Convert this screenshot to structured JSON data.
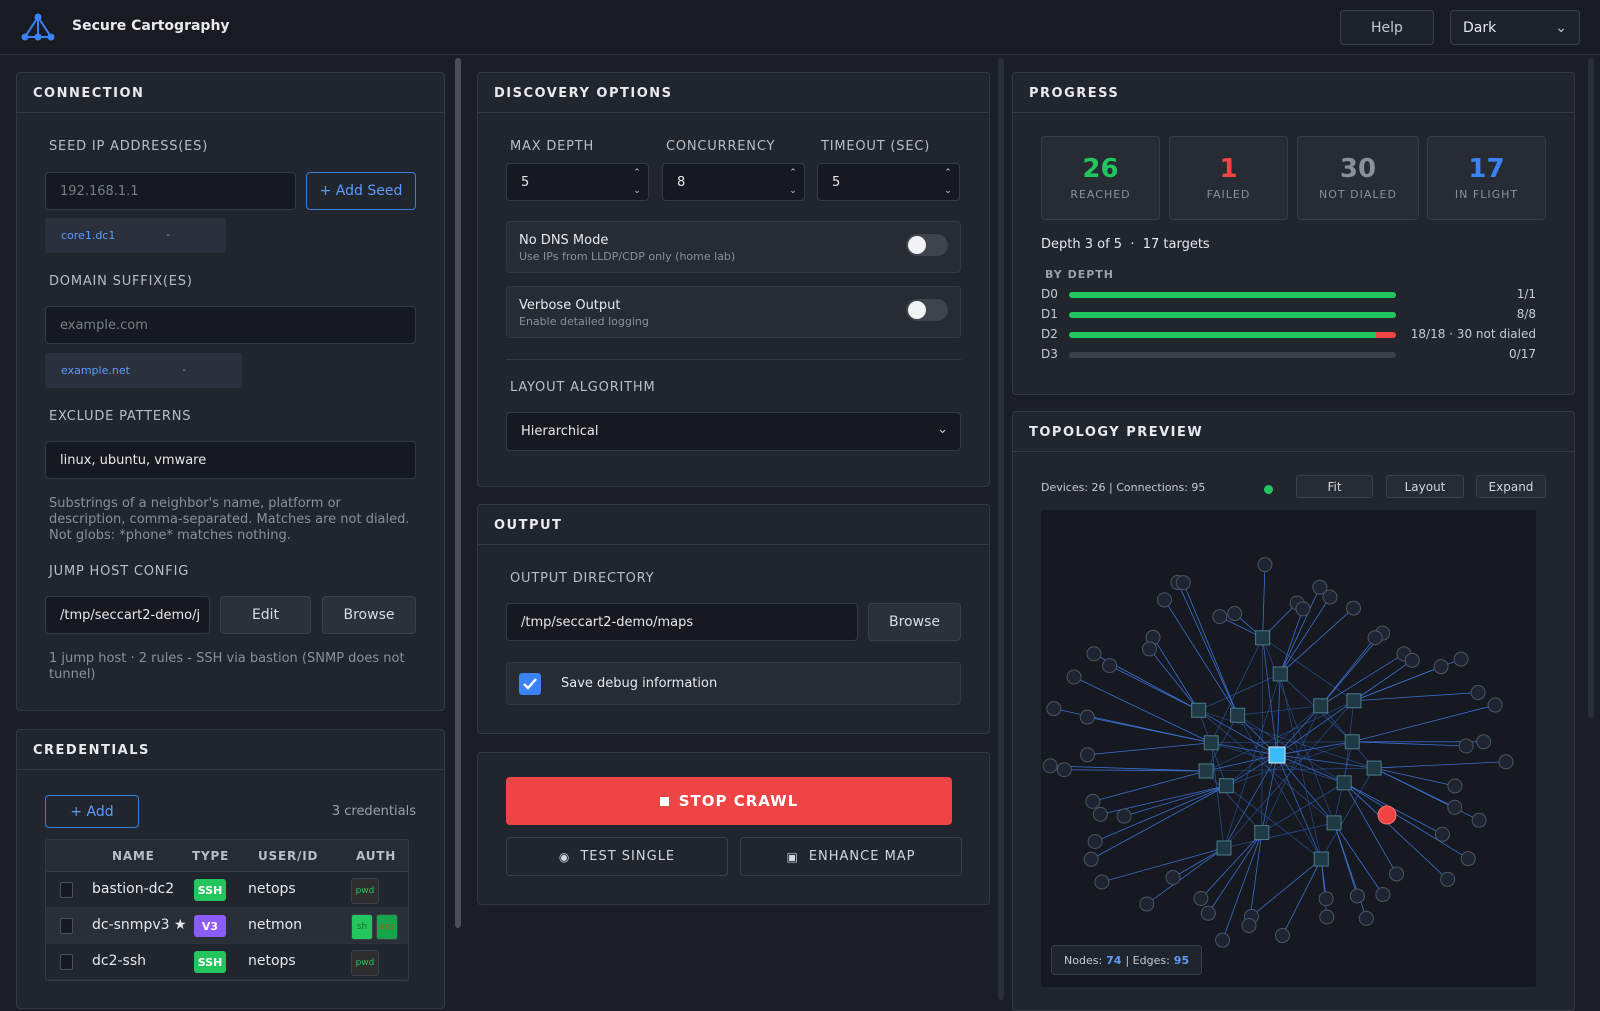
{
  "app": {
    "title": "Secure Cartography",
    "help_label": "Help",
    "theme": "Dark"
  },
  "connection": {
    "title": "CONNECTION",
    "seed_label": "SEED IP ADDRESS(ES)",
    "seed_placeholder": "192.168.1.1",
    "add_seed_label": "+ Add Seed",
    "seed_tags": [
      "core1.dc1"
    ],
    "domain_label": "DOMAIN SUFFIX(ES)",
    "domain_placeholder": "example.com",
    "domain_tags": [
      "example.net"
    ],
    "exclude_label": "EXCLUDE PATTERNS",
    "exclude_value": "linux, ubuntu, vmware",
    "exclude_help": [
      "Substrings of a neighbor's name, platform or",
      "description, comma-separated. Matches are not dialed.",
      "Not globs: *phone* matches nothing."
    ],
    "jump_label": "JUMP HOST CONFIG",
    "jump_value": "/tmp/seccart2-demo/j",
    "edit_label": "Edit",
    "browse_label": "Browse",
    "jump_help": [
      "1 jump host · 2 rules - SSH via bastion (SNMP does not",
      "tunnel)"
    ]
  },
  "credentials": {
    "title": "CREDENTIALS",
    "add_label": "+ Add",
    "count_text": "3 credentials",
    "headers": [
      "NAME",
      "TYPE",
      "USER/ID",
      "AUTH"
    ],
    "rows": [
      {
        "name": "bastion-dc2",
        "type": "SSH",
        "user": "netops",
        "auth": [
          "pwd"
        ]
      },
      {
        "name": "dc-snmpv3 ★",
        "type": "V3",
        "user": "netmon",
        "auth": [
          "sh",
          "aes"
        ]
      },
      {
        "name": "dc2-ssh",
        "type": "SSH",
        "user": "netops",
        "auth": [
          "pwd"
        ]
      }
    ]
  },
  "discovery": {
    "title": "DISCOVERY OPTIONS",
    "max_depth_label": "MAX DEPTH",
    "max_depth": "5",
    "concurrency_label": "CONCURRENCY",
    "concurrency": "8",
    "timeout_label": "TIMEOUT (SEC)",
    "timeout": "5",
    "no_dns_title": "No DNS Mode",
    "no_dns_sub": "Use IPs from LLDP/CDP only (home lab)",
    "verbose_title": "Verbose Output",
    "verbose_sub": "Enable detailed logging",
    "layout_label": "LAYOUT ALGORITHM",
    "layout_value": "Hierarchical"
  },
  "output": {
    "title": "OUTPUT",
    "dir_label": "OUTPUT DIRECTORY",
    "dir_value": "/tmp/seccart2-demo/maps",
    "browse_label": "Browse",
    "debug_label": "Save debug information"
  },
  "actions": {
    "stop_label": "STOP CRAWL",
    "test_label": "TEST SINGLE",
    "enhance_label": "ENHANCE MAP"
  },
  "progress": {
    "title": "PROGRESS",
    "stats": [
      {
        "value": "26",
        "label": "REACHED",
        "color": "#22c55e"
      },
      {
        "value": "1",
        "label": "FAILED",
        "color": "#ef4444"
      },
      {
        "value": "30",
        "label": "NOT DIALED",
        "color": "#8a8f99"
      },
      {
        "value": "17",
        "label": "IN FLIGHT",
        "color": "#3b82f6"
      }
    ],
    "depth_text": "Depth 3 of 5  ·  17 targets",
    "by_depth_label": "BY DEPTH",
    "depths": [
      {
        "label": "D0",
        "fraction": 1.0,
        "failed_fraction": 0,
        "count": "1/1"
      },
      {
        "label": "D1",
        "fraction": 1.0,
        "failed_fraction": 0,
        "count": "8/8"
      },
      {
        "label": "D2",
        "fraction": 0.94,
        "failed_fraction": 0.06,
        "count": "18/18  ·  30 not dialed"
      },
      {
        "label": "D3",
        "fraction": 0,
        "failed_fraction": 0,
        "count": "0/17"
      }
    ]
  },
  "topology": {
    "title": "TOPOLOGY PREVIEW",
    "summary": "Devices: 26 | Connections: 95",
    "status_color": "#22c55e",
    "fit_label": "Fit",
    "layout_label": "Layout",
    "expand_label": "Expand",
    "nodes_label": "Nodes:",
    "nodes": "74",
    "edges_label": "| Edges:",
    "edges": "95"
  }
}
